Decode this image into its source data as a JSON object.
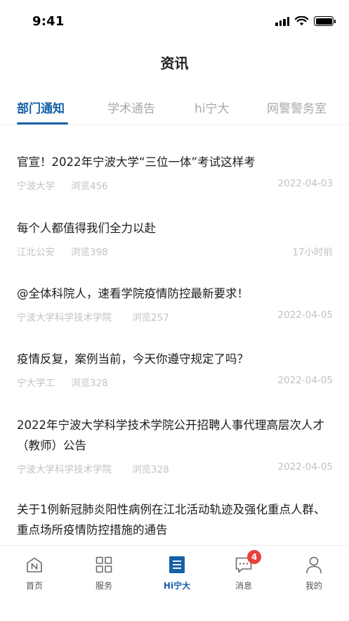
{
  "status_bar": {
    "time": "9:41"
  },
  "header": {
    "title": "资讯"
  },
  "tabs": [
    {
      "label": "部门通知",
      "active": true
    },
    {
      "label": "学术通告",
      "active": false
    },
    {
      "label": "hi宁大",
      "active": false
    },
    {
      "label": "网警警务室",
      "active": false
    }
  ],
  "news": [
    {
      "title": "官宣！2022年宁波大学“三位一体”考试这样考",
      "source": "宁波大学",
      "views": "浏览456",
      "date": "2022-04-03"
    },
    {
      "title": "每个人都值得我们全力以赴",
      "source": "江北公安",
      "views": "浏览398",
      "date": "17小时前"
    },
    {
      "title": "@全体科院人，速看学院疫情防控最新要求！",
      "source": "宁波大学科学技术学院",
      "views": "浏览257",
      "date": "2022-04-05"
    },
    {
      "title": "疫情反复，案例当前，今天你遵守规定了吗？",
      "source": "宁大学工",
      "views": "浏览328",
      "date": "2022-04-05"
    },
    {
      "title": "2022年宁波大学科学技术学院公开招聘人事代理高层次人才（教师）公告",
      "source": "宁波大学科学技术学院",
      "views": "浏览328",
      "date": "2022-04-05"
    },
    {
      "title": "关于1例新冠肺炎阳性病例在江北活动轨迹及强化重点人群、重点场所疫情防控措施的通告",
      "source": "",
      "views": "",
      "date": ""
    }
  ],
  "tab_bar": {
    "items": [
      {
        "label": "首页",
        "icon": "home-n-icon",
        "active": false
      },
      {
        "label": "服务",
        "icon": "grid-icon",
        "active": false
      },
      {
        "label": "Hi宁大",
        "icon": "list-doc-icon",
        "active": true
      },
      {
        "label": "消息",
        "icon": "chat-icon",
        "active": false,
        "badge": "4"
      },
      {
        "label": "我的",
        "icon": "user-icon",
        "active": false
      }
    ]
  },
  "colors": {
    "accent": "#1660a8",
    "badge": "#e8413b",
    "meta_text": "#c2c2c2",
    "inactive_tab": "#a8a8a8"
  }
}
